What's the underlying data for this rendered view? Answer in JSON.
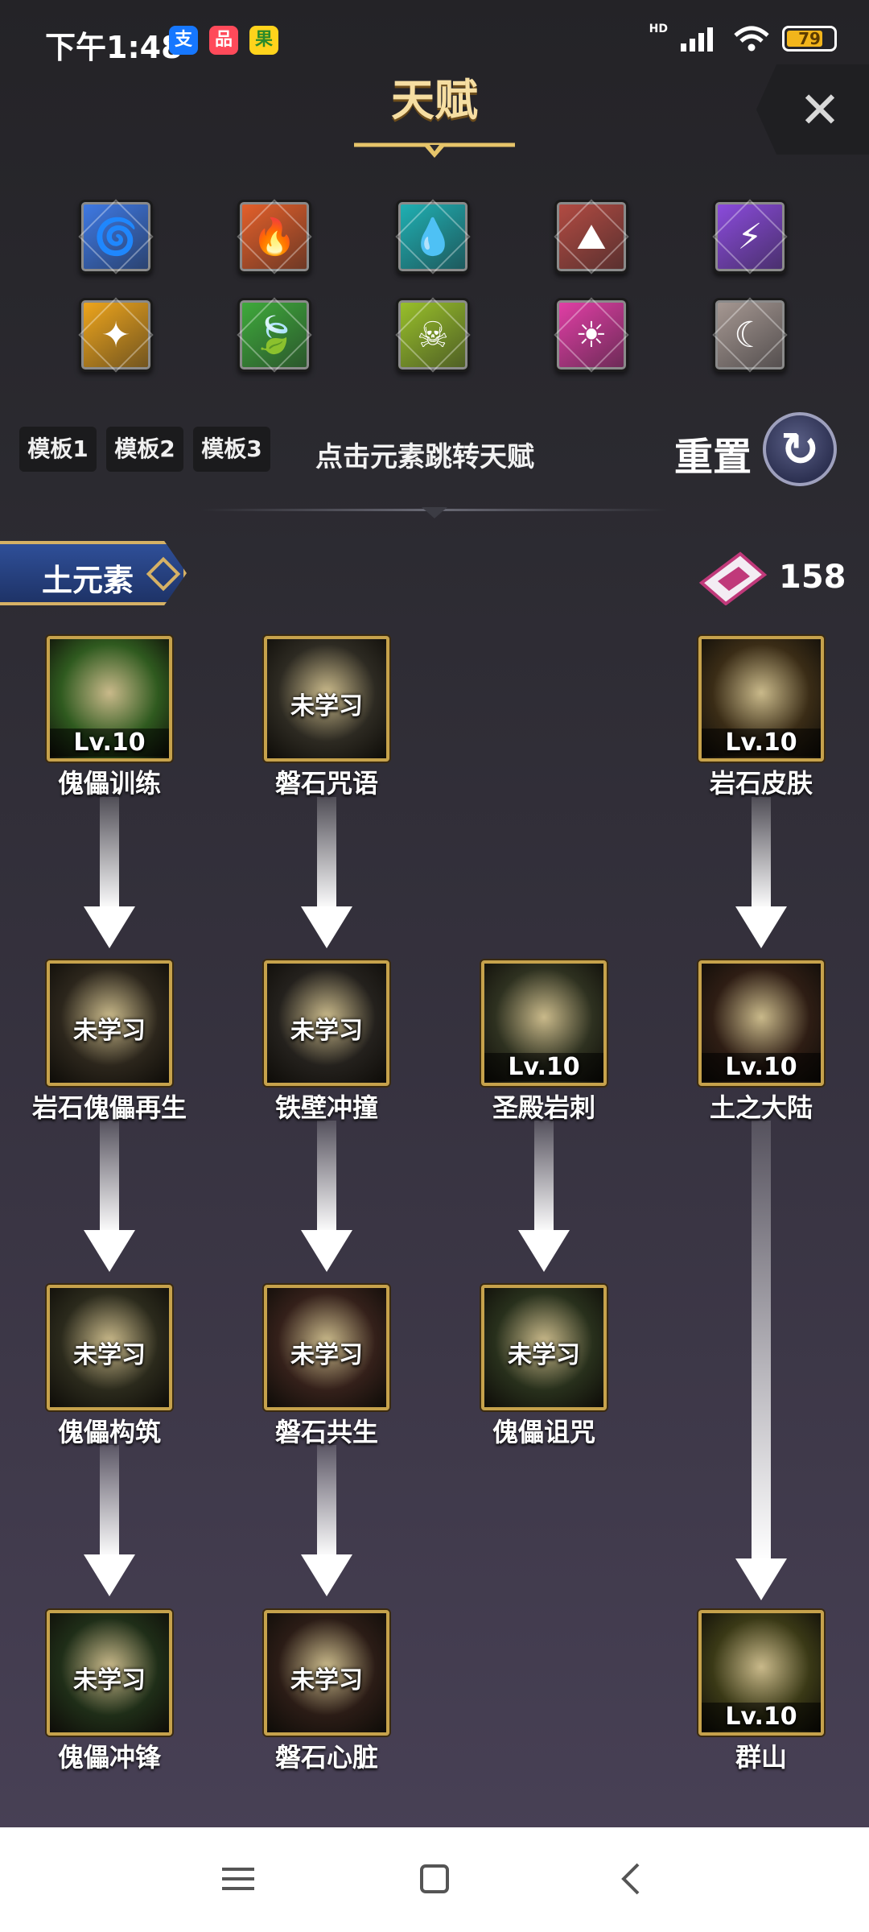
{
  "status_bar": {
    "time": "下午1:48",
    "app_icons": [
      "支",
      "品",
      "果"
    ],
    "network": "HD",
    "battery": "79",
    "battery_level": 0.79
  },
  "header": {
    "title": "天赋"
  },
  "elements": [
    {
      "name": "wind",
      "icon": "tornado-icon",
      "color": "#3f7be8",
      "glyph": "🌀"
    },
    {
      "name": "fire",
      "icon": "flame-icon",
      "color": "#e8612a",
      "glyph": "🔥"
    },
    {
      "name": "water",
      "icon": "droplet-icon",
      "color": "#1fb3b6",
      "glyph": "💧"
    },
    {
      "name": "rock",
      "icon": "mountain-icon",
      "color": "#b54c43",
      "glyph": "⛰"
    },
    {
      "name": "thunder",
      "icon": "lightning-icon",
      "color": "#8d4ce0",
      "glyph": "⚡"
    },
    {
      "name": "light",
      "icon": "prism-icon",
      "color": "#f2a81c",
      "glyph": "✦"
    },
    {
      "name": "nature",
      "icon": "leaf-icon",
      "color": "#3fad3c",
      "glyph": "🍃"
    },
    {
      "name": "poison",
      "icon": "skull-icon",
      "color": "#9bc32a",
      "glyph": "☠"
    },
    {
      "name": "holy",
      "icon": "sun-icon",
      "color": "#e53fa8",
      "glyph": "☀"
    },
    {
      "name": "moon",
      "icon": "moon-icon",
      "color": "#a89a94",
      "glyph": "☾"
    }
  ],
  "templates": [
    "模板1",
    "模板2",
    "模板3"
  ],
  "hint": "点击元素跳转天赋",
  "reset_label": "重置",
  "section_label": "土元素",
  "points": "158",
  "talents": [
    {
      "name": "傀儡训练",
      "status": "Lv.10",
      "learned": true,
      "bg": "#2f5a1f"
    },
    {
      "name": "磐石咒语",
      "status": "未学习",
      "learned": false,
      "bg": "#2d2a22"
    },
    {
      "name": "岩石皮肤",
      "status": "Lv.10",
      "learned": true,
      "bg": "#3a2c16"
    },
    {
      "name": "岩石傀儡再生",
      "status": "未学习",
      "learned": false,
      "bg": "#2c261c"
    },
    {
      "name": "铁壁冲撞",
      "status": "未学习",
      "learned": false,
      "bg": "#24211d"
    },
    {
      "name": "圣殿岩刺",
      "status": "Lv.10",
      "learned": true,
      "bg": "#2e3120"
    },
    {
      "name": "土之大陆",
      "status": "Lv.10",
      "learned": true,
      "bg": "#2e1d14"
    },
    {
      "name": "傀儡构筑",
      "status": "未学习",
      "learned": false,
      "bg": "#2b2a1c"
    },
    {
      "name": "磐石共生",
      "status": "未学习",
      "learned": false,
      "bg": "#34201a"
    },
    {
      "name": "傀儡诅咒",
      "status": "未学习",
      "learned": false,
      "bg": "#28301c"
    },
    {
      "name": "傀儡冲锋",
      "status": "未学习",
      "learned": false,
      "bg": "#1f2e18"
    },
    {
      "name": "磐石心脏",
      "status": "未学习",
      "learned": false,
      "bg": "#2b1c16"
    },
    {
      "name": "群山",
      "status": "Lv.10",
      "learned": true,
      "bg": "#3a3916"
    }
  ],
  "nav": {
    "menu": "menu-icon",
    "home": "home-icon",
    "back": "back-icon"
  }
}
